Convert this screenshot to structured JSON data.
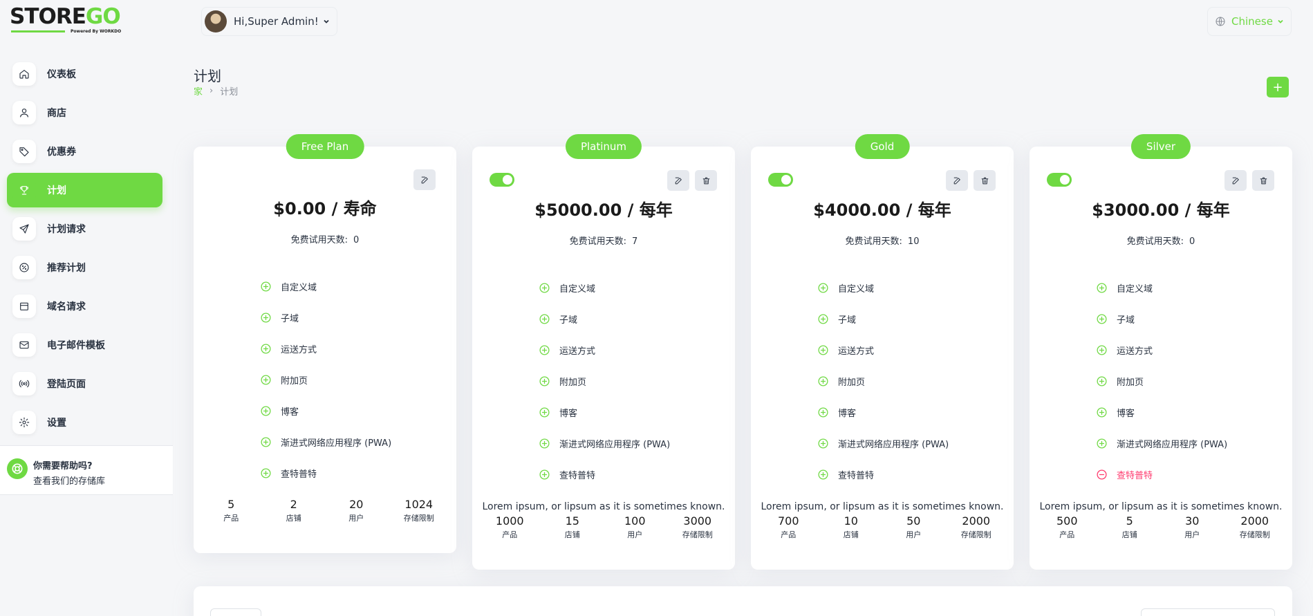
{
  "brand": {
    "logo_main": "STORE",
    "logo_accent": "GO",
    "logo_sub": "Powered By WORKDO"
  },
  "header": {
    "user_greeting": "Hi,Super Admin!",
    "language": "Chinese"
  },
  "sidebar": {
    "items": [
      {
        "label": "仪表板",
        "icon": "home-icon"
      },
      {
        "label": "商店",
        "icon": "user-icon"
      },
      {
        "label": "优惠券",
        "icon": "tag-icon"
      },
      {
        "label": "计划",
        "icon": "trophy-icon",
        "active": true
      },
      {
        "label": "计划请求",
        "icon": "send-icon"
      },
      {
        "label": "推荐计划",
        "icon": "discount-icon"
      },
      {
        "label": "域名请求",
        "icon": "calendar-icon"
      },
      {
        "label": "电子邮件模板",
        "icon": "mail-icon"
      },
      {
        "label": "登陆页面",
        "icon": "broadcast-icon"
      },
      {
        "label": "设置",
        "icon": "gear-icon"
      }
    ],
    "help": {
      "title": "你需要帮助吗?",
      "subtitle": "查看我们的存储库"
    }
  },
  "page": {
    "title": "计划",
    "breadcrumb": {
      "home": "家",
      "separator": "›",
      "current": "计划"
    },
    "add_label": "+"
  },
  "plans": [
    {
      "name": "Free Plan",
      "price": "$0.00 / 寿命",
      "trial_label": "免费试用天数:",
      "trial_days": "0",
      "features": [
        {
          "label": "自定义域",
          "enabled": true
        },
        {
          "label": "子域",
          "enabled": true
        },
        {
          "label": "运送方式",
          "enabled": true
        },
        {
          "label": "附加页",
          "enabled": true
        },
        {
          "label": "博客",
          "enabled": true
        },
        {
          "label": "渐进式网络应用程序 (PWA)",
          "enabled": true
        },
        {
          "label": "查特普特",
          "enabled": true
        }
      ],
      "description": "",
      "stats": [
        {
          "value": "5",
          "label": "产品"
        },
        {
          "value": "2",
          "label": "店铺"
        },
        {
          "value": "20",
          "label": "用户"
        },
        {
          "value": "1024",
          "label": "存储限制"
        }
      ]
    },
    {
      "name": "Platinum",
      "price": "$5000.00 / 每年",
      "trial_label": "免费试用天数:",
      "trial_days": "7",
      "features": [
        {
          "label": "自定义域",
          "enabled": true
        },
        {
          "label": "子域",
          "enabled": true
        },
        {
          "label": "运送方式",
          "enabled": true
        },
        {
          "label": "附加页",
          "enabled": true
        },
        {
          "label": "博客",
          "enabled": true
        },
        {
          "label": "渐进式网络应用程序 (PWA)",
          "enabled": true
        },
        {
          "label": "查特普特",
          "enabled": true
        }
      ],
      "description": "Lorem ipsum, or lipsum as it is sometimes known.",
      "stats": [
        {
          "value": "1000",
          "label": "产品"
        },
        {
          "value": "15",
          "label": "店铺"
        },
        {
          "value": "100",
          "label": "用户"
        },
        {
          "value": "3000",
          "label": "存储限制"
        }
      ]
    },
    {
      "name": "Gold",
      "price": "$4000.00 / 每年",
      "trial_label": "免费试用天数:",
      "trial_days": "10",
      "features": [
        {
          "label": "自定义域",
          "enabled": true
        },
        {
          "label": "子域",
          "enabled": true
        },
        {
          "label": "运送方式",
          "enabled": true
        },
        {
          "label": "附加页",
          "enabled": true
        },
        {
          "label": "博客",
          "enabled": true
        },
        {
          "label": "渐进式网络应用程序 (PWA)",
          "enabled": true
        },
        {
          "label": "查特普特",
          "enabled": true
        }
      ],
      "description": "Lorem ipsum, or lipsum as it is sometimes known.",
      "stats": [
        {
          "value": "700",
          "label": "产品"
        },
        {
          "value": "10",
          "label": "店铺"
        },
        {
          "value": "50",
          "label": "用户"
        },
        {
          "value": "2000",
          "label": "存储限制"
        }
      ]
    },
    {
      "name": "Silver",
      "price": "$3000.00 / 每年",
      "trial_label": "免费试用天数:",
      "trial_days": "0",
      "features": [
        {
          "label": "自定义域",
          "enabled": true
        },
        {
          "label": "子域",
          "enabled": true
        },
        {
          "label": "运送方式",
          "enabled": true
        },
        {
          "label": "附加页",
          "enabled": true
        },
        {
          "label": "博客",
          "enabled": true
        },
        {
          "label": "渐进式网络应用程序 (PWA)",
          "enabled": true
        },
        {
          "label": "查特普特",
          "enabled": false
        }
      ],
      "description": "Lorem ipsum, or lipsum as it is sometimes known.",
      "stats": [
        {
          "value": "500",
          "label": "产品"
        },
        {
          "value": "5",
          "label": "店铺"
        },
        {
          "value": "30",
          "label": "用户"
        },
        {
          "value": "2000",
          "label": "存储限制"
        }
      ]
    }
  ],
  "colors": {
    "accent": "#6fd943",
    "danger": "#ff3a6e",
    "text": "#293240"
  }
}
